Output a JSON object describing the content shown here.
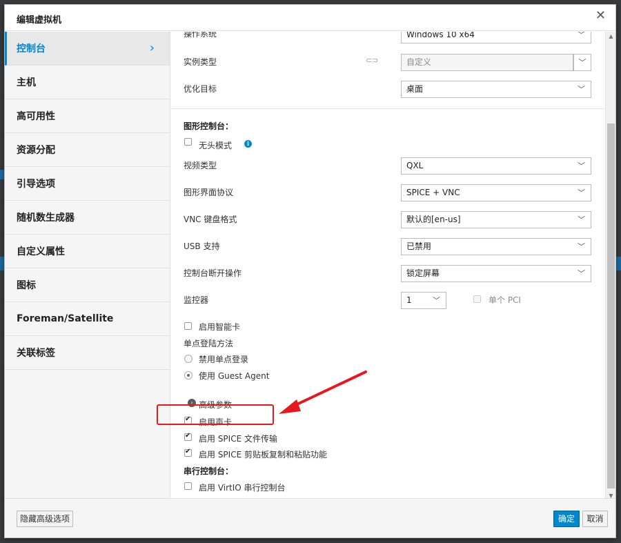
{
  "dialog": {
    "title": "编辑虚拟机"
  },
  "sidebar": {
    "items": [
      {
        "label": "控制台"
      },
      {
        "label": "主机"
      },
      {
        "label": "高可用性"
      },
      {
        "label": "资源分配"
      },
      {
        "label": "引导选项"
      },
      {
        "label": "随机数生成器"
      },
      {
        "label": "自定义属性"
      },
      {
        "label": "图标"
      },
      {
        "label": "Foreman/Satellite"
      },
      {
        "label": "关联标签"
      }
    ]
  },
  "general": {
    "os_label": "操作系统",
    "os_value": "Windows 10 x64",
    "instance_type_label": "实例类型",
    "instance_type_value": "自定义",
    "optimize_label": "优化目标",
    "optimize_value": "桌面"
  },
  "graphics": {
    "heading": "图形控制台：",
    "headless_label": "无头模式",
    "video_type_label": "视频类型",
    "video_type_value": "QXL",
    "protocol_label": "图形界面协议",
    "protocol_value": "SPICE + VNC",
    "vnc_keymap_label": "VNC 键盘格式",
    "vnc_keymap_value": "默认的[en-us]",
    "usb_label": "USB 支持",
    "usb_value": "已禁用",
    "disconnect_label": "控制台断开操作",
    "disconnect_value": "锁定屏幕",
    "monitors_label": "监控器",
    "monitors_value": "1",
    "single_pci_label": "单个 PCI",
    "smartcard_label": "启用智能卡",
    "sso_label": "单点登陆方法",
    "sso_disable_label": "禁用单点登录",
    "sso_guest_agent_label": "使用 Guest Agent",
    "advanced_label": "高级参数",
    "soundcard_label": "启用声卡",
    "spice_file_label": "启用 SPICE 文件传输",
    "spice_clipboard_label": "启用 SPICE 剪贴板复制和粘贴功能"
  },
  "serial": {
    "heading": "串行控制台：",
    "virtio_label": "启用 VirtIO 串行控制台"
  },
  "footer": {
    "hide_advanced_label": "隐藏高级选项",
    "ok_label": "确定",
    "cancel_label": "取消"
  },
  "colors": {
    "accent": "#0088ce",
    "highlight": "#e8171c"
  }
}
